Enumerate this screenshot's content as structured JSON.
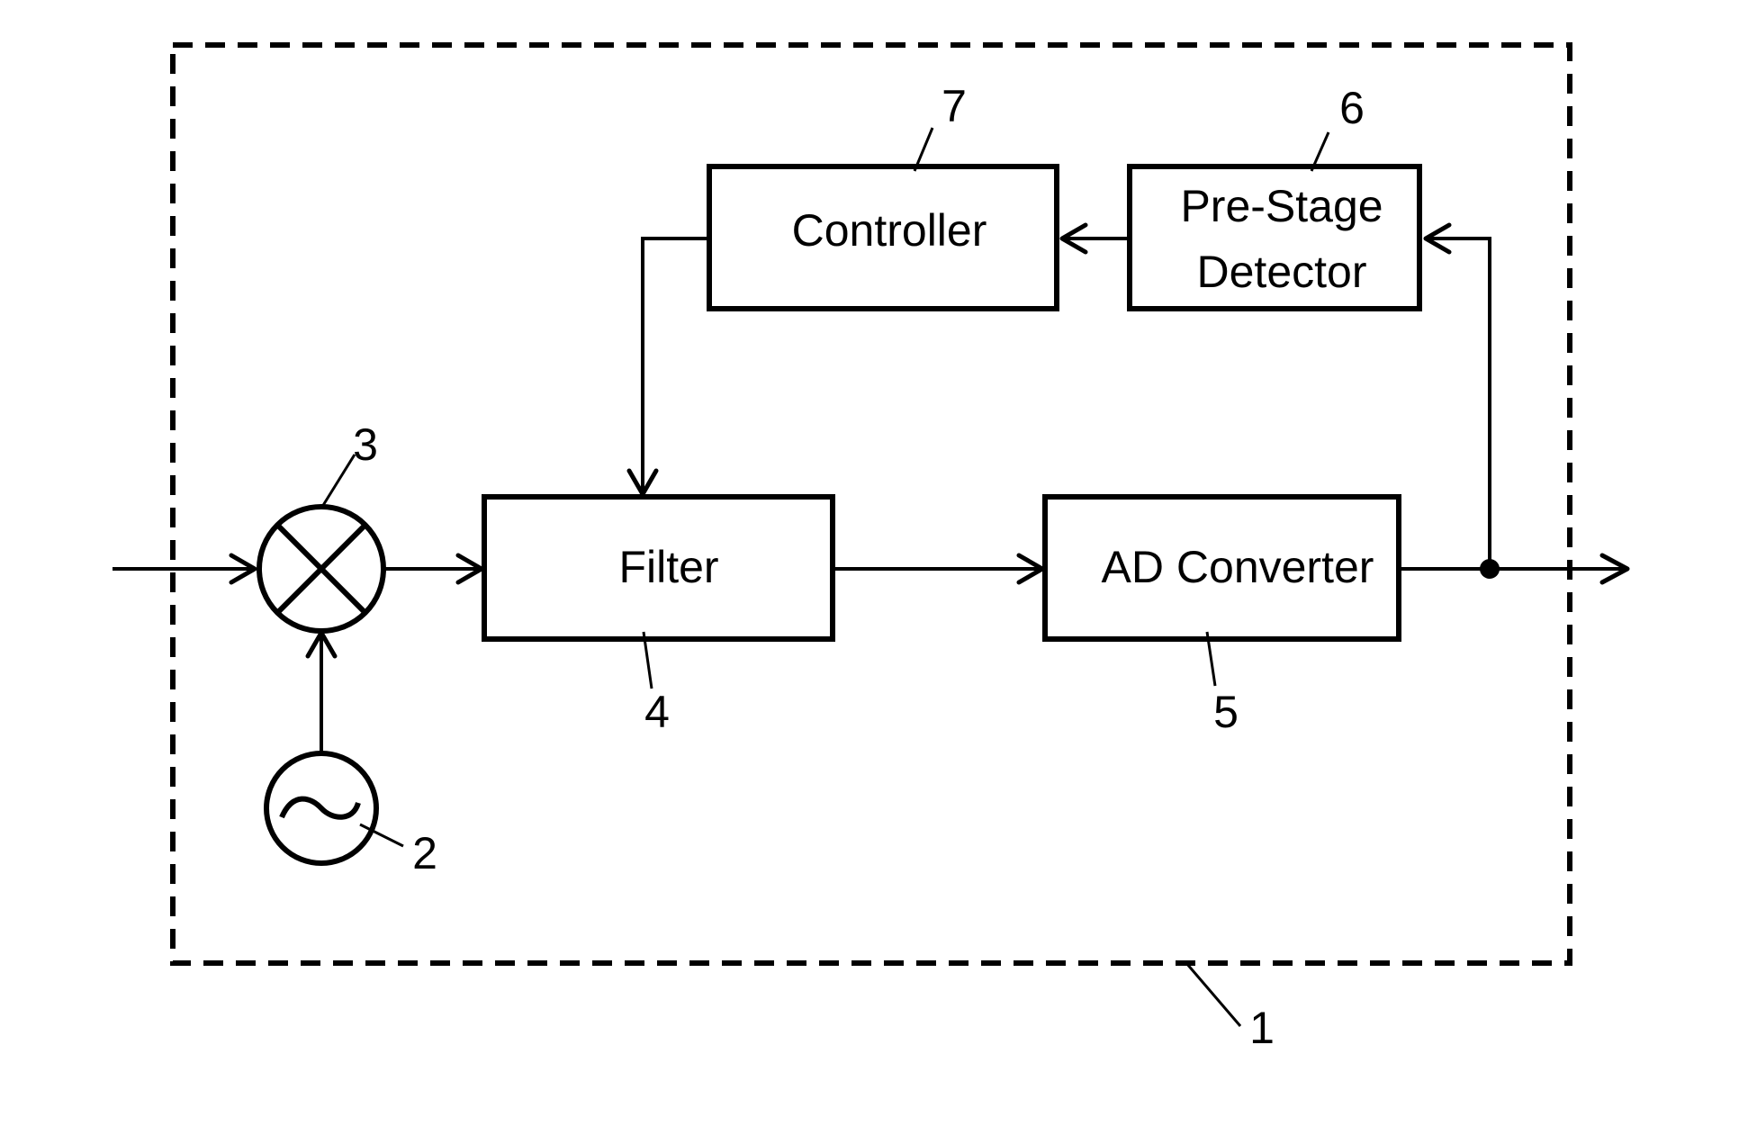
{
  "diagram": {
    "type": "block-diagram",
    "blocks": {
      "controller": {
        "label": "Controller",
        "ref": "7"
      },
      "pre_stage_detector": {
        "label_line1": "Pre-Stage",
        "label_line2": "Detector",
        "ref": "6"
      },
      "filter": {
        "label": "Filter",
        "ref": "4"
      },
      "ad_converter": {
        "label": "AD Converter",
        "ref": "5"
      },
      "mixer": {
        "symbol": "multiply",
        "ref": "3"
      },
      "oscillator": {
        "symbol": "sine-wave",
        "ref": "2"
      },
      "enclosure": {
        "style": "dashed",
        "ref": "1"
      }
    },
    "connections": [
      {
        "from": "input",
        "to": "mixer"
      },
      {
        "from": "oscillator",
        "to": "mixer"
      },
      {
        "from": "mixer",
        "to": "filter"
      },
      {
        "from": "filter",
        "to": "ad_converter"
      },
      {
        "from": "ad_converter",
        "to": "output"
      },
      {
        "from": "ad_converter",
        "to": "pre_stage_detector"
      },
      {
        "from": "pre_stage_detector",
        "to": "controller"
      },
      {
        "from": "controller",
        "to": "filter"
      }
    ]
  }
}
